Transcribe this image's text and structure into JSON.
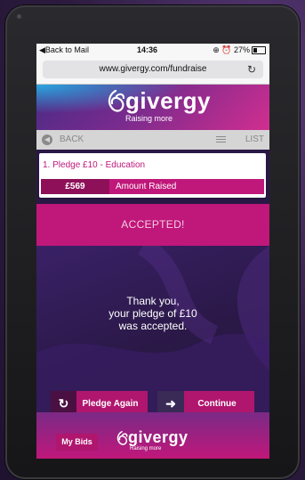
{
  "status_bar": {
    "back_text": "◀Back to Mail",
    "time": "14:36",
    "battery_text": "⊕ ⏰ 27%",
    "battery_level_percent": 27
  },
  "browser": {
    "url": "www.givergy.com/fundraise",
    "reload_icon": "reload-icon"
  },
  "header": {
    "logo_text": "givergy",
    "tagline": "Raising more"
  },
  "nav": {
    "back_label": "BACK",
    "list_label": "LIST"
  },
  "item": {
    "title": "1. Pledge £10 - Education",
    "amount_value": "£569",
    "amount_label": "Amount Raised"
  },
  "banner": {
    "text": "ACCEPTED!"
  },
  "message": {
    "line1": "Thank you,",
    "line2": "your pledge of £10",
    "line3": "was accepted."
  },
  "buttons": {
    "pledge_again": "Pledge Again",
    "continue": "Continue"
  },
  "footer": {
    "my_bids": "My Bids",
    "logo_text": "givergy",
    "tagline": "Raising more"
  },
  "colors": {
    "brand_pink": "#c0177a",
    "brand_purple": "#2a1846"
  }
}
